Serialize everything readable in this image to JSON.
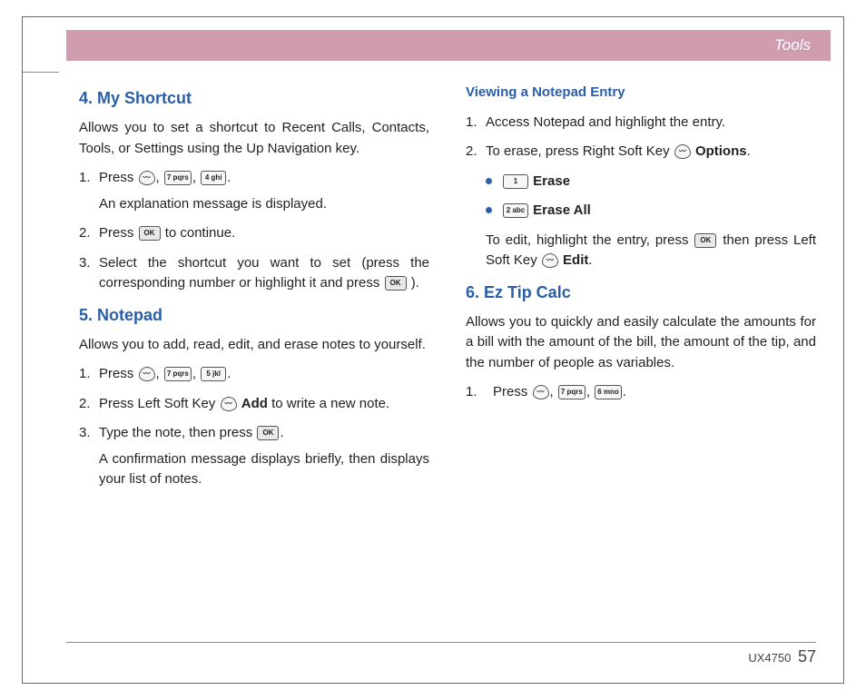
{
  "header": {
    "title": "Tools"
  },
  "left": {
    "sec4": {
      "heading": "4. My Shortcut",
      "intro": "Allows you to set a shortcut to Recent Calls, Contacts, Tools, or Settings using the Up Navigation key.",
      "step1_a": "Press ",
      "step1_b": "An explanation message is displayed.",
      "step2_a": "Press ",
      "step2_b": " to continue.",
      "step3": "Select the shortcut you want to set (press the corresponding number or highlight it and press ",
      "step3_end": ")."
    },
    "sec5": {
      "heading": "5. Notepad",
      "intro": "Allows you to add, read, edit, and erase notes to yourself.",
      "step1": "Press ",
      "step2_a": "Press Left Soft Key ",
      "step2_bold": "Add",
      "step2_b": " to write a new note.",
      "step3_a": "Type the note, then press ",
      "step3_b": "A confirmation message displays briefly, then displays your list of notes."
    }
  },
  "right": {
    "sub": "Viewing a Notepad Entry",
    "step1": "Access Notepad and highlight the entry.",
    "step2_a": "To erase, press Right Soft Key ",
    "step2_bold": "Options",
    "step2_b": ".",
    "erase": "Erase",
    "erase_all": "Erase All",
    "edit_a": "To edit, highlight the entry, press ",
    "edit_b": " then press Left Soft Key ",
    "edit_bold": "Edit",
    "edit_c": ".",
    "sec6": {
      "heading": "6. Ez Tip Calc",
      "intro": "Allows you to quickly and easily calculate the amounts for a bill with the amount of the bill, the amount of the tip, and the number of people as variables.",
      "step1": "Press "
    }
  },
  "keys": {
    "seven": "7 pqrs",
    "four": "4 ghi",
    "five": "5 jkl",
    "six": "6 mno",
    "one": "1",
    "two": "2 abc",
    "ok": "OK"
  },
  "footer": {
    "model": "UX4750",
    "page": "57"
  },
  "numbers": {
    "n1": "1.",
    "n2": "2.",
    "n3": "3."
  },
  "punct": {
    "comma_sp": ", ",
    "period": "."
  }
}
